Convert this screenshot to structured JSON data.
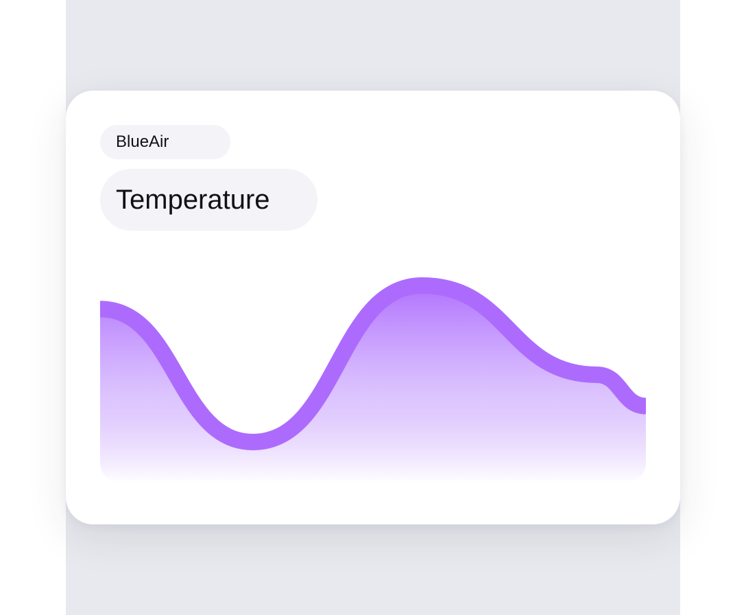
{
  "card": {
    "brand_label": "BlueAir",
    "metric_title": "Temperature"
  },
  "colors": {
    "page_background": "#e8e9ee",
    "card_background": "#ffffff",
    "chip_background": "#f3f3f8",
    "accent": "#ad6bfd"
  },
  "chart_data": {
    "type": "area",
    "title": "",
    "xlabel": "",
    "ylabel": "",
    "grid": false,
    "legend": "none",
    "x": [
      0,
      0.28,
      0.59,
      0.91,
      1.0
    ],
    "y": [
      0.85,
      0.0,
      1.0,
      0.43,
      0.23
    ],
    "ylim": [
      0,
      1
    ],
    "smooth": true
  }
}
